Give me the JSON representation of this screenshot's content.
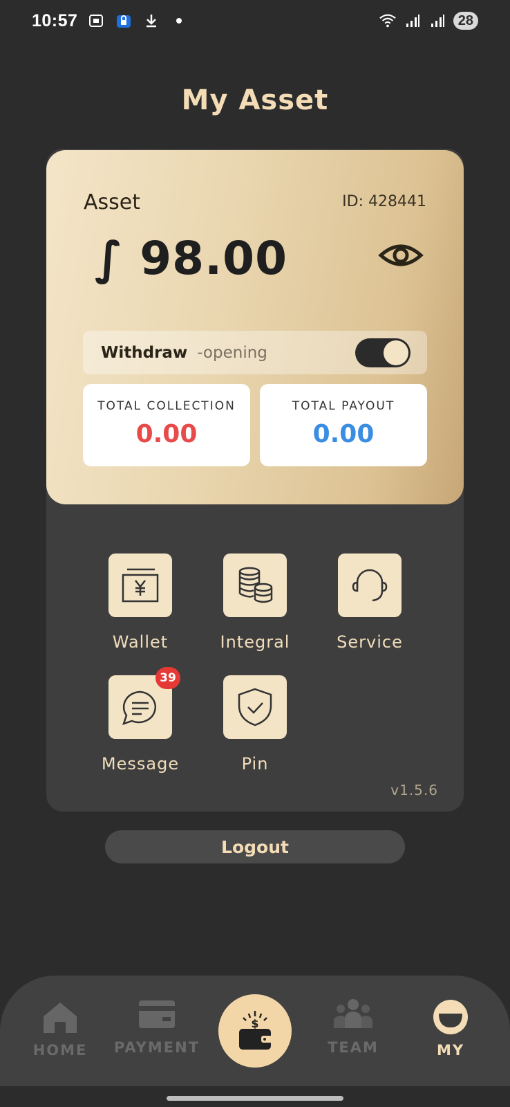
{
  "status_bar": {
    "time": "10:57",
    "battery": "28"
  },
  "page": {
    "title": "My Asset"
  },
  "asset_card": {
    "label": "Asset",
    "id_text": "ID: 428441",
    "amount": "∫ 98.00",
    "withdraw": {
      "label": "Withdraw",
      "status": "-opening",
      "enabled": true
    },
    "stats": [
      {
        "label": "TOTAL COLLECTION",
        "value": "0.00",
        "color": "#e84a4a"
      },
      {
        "label": "TOTAL PAYOUT",
        "value": "0.00",
        "color": "#3a8de0"
      }
    ]
  },
  "menu": {
    "items": [
      {
        "label": "Wallet",
        "icon": "wallet-yen-icon"
      },
      {
        "label": "Integral",
        "icon": "coins-icon"
      },
      {
        "label": "Service",
        "icon": "headset-icon"
      },
      {
        "label": "Message",
        "icon": "chat-icon",
        "badge": "39"
      },
      {
        "label": "Pin",
        "icon": "shield-check-icon"
      }
    ]
  },
  "version": "v1.5.6",
  "logout": {
    "label": "Logout"
  },
  "bottom_nav": {
    "items": [
      {
        "label": "HOME",
        "icon": "home-icon",
        "active": false
      },
      {
        "label": "PAYMENT",
        "icon": "card-icon",
        "active": false
      },
      {
        "label": "",
        "icon": "wallet-money-icon",
        "active": false
      },
      {
        "label": "TEAM",
        "icon": "team-icon",
        "active": false
      },
      {
        "label": "MY",
        "icon": "profile-icon",
        "active": true
      }
    ]
  },
  "colors": {
    "background": "#2c2c2c",
    "accent_gold": "#f3dcb6",
    "panel": "#3e3e3e",
    "badge_red": "#e53935"
  }
}
